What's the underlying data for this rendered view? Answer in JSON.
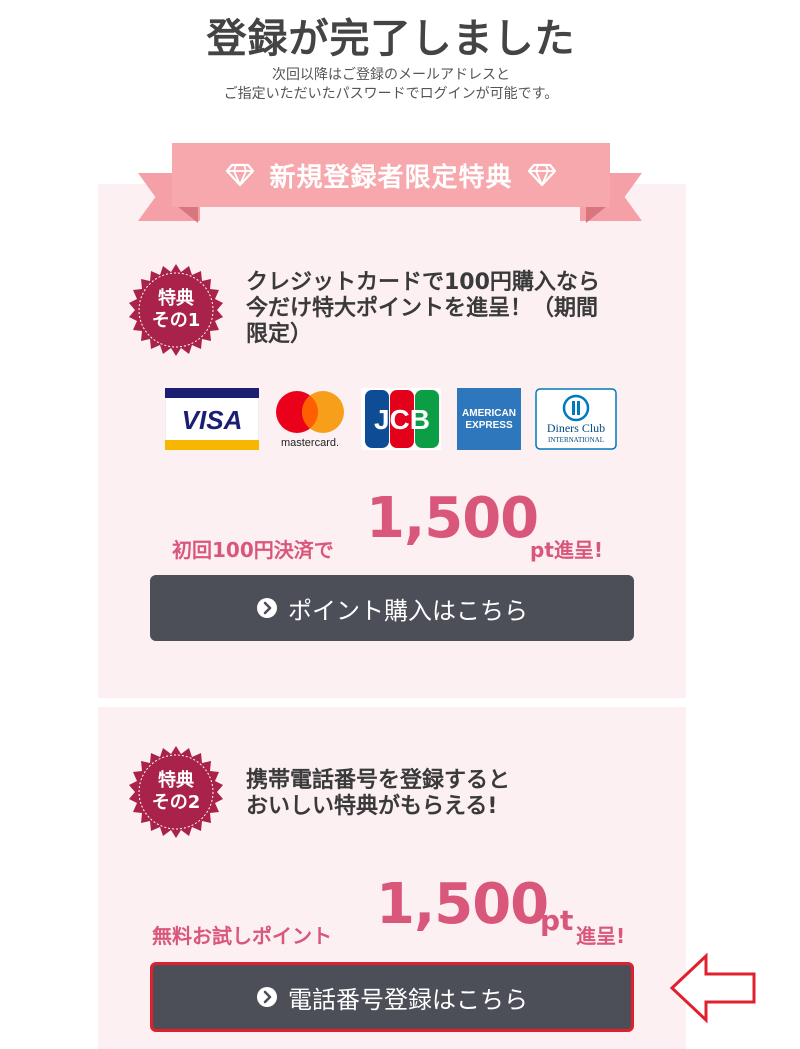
{
  "header": {
    "title": "登録が完了しました",
    "subtitle_line1": "次回以降はご登録のメールアドレスと",
    "subtitle_line2": "ご指定いただいたパスワードでログインが可能です。"
  },
  "ribbon": {
    "label": "新規登録者限定特典"
  },
  "benefit1": {
    "badge_line1": "特典",
    "badge_line2": "その1",
    "text_line1": "クレジットカードで100円購入なら",
    "text_line2": "今だけ特大ポイントを進呈！（期間",
    "text_line3": "限定）",
    "cards": [
      {
        "name": "VISA"
      },
      {
        "name": "mastercard."
      },
      {
        "name": "JCB"
      },
      {
        "name_line1": "AMERICAN",
        "name_line2": "EXPRESS"
      },
      {
        "name_line1": "Diners Club",
        "name_line2": "INTERNATIONAL"
      }
    ],
    "promo_prefix": "初回100円決済で",
    "promo_amount": "1,500",
    "promo_suffix": "pt進呈!",
    "button_label": "ポイント購入はこちら"
  },
  "benefit2": {
    "badge_line1": "特典",
    "badge_line2": "その2",
    "text_line1": "携帯電話番号を登録すると",
    "text_line2": "おいしい特典がもらえる!",
    "promo_prefix": "無料お試しポイント",
    "promo_amount": "1,500",
    "promo_pt": "pt",
    "promo_suffix": "進呈!",
    "button_label": "電話番号登録はこちら"
  },
  "colors": {
    "accent_pink": "#d9577a",
    "ribbon": "#f7a8ad",
    "badge": "#a8224a",
    "button": "#4c4f58",
    "highlight": "#e0202d"
  },
  "icons": [
    "diamond-icon",
    "chevron-circle-icon",
    "arrow-left-icon"
  ]
}
